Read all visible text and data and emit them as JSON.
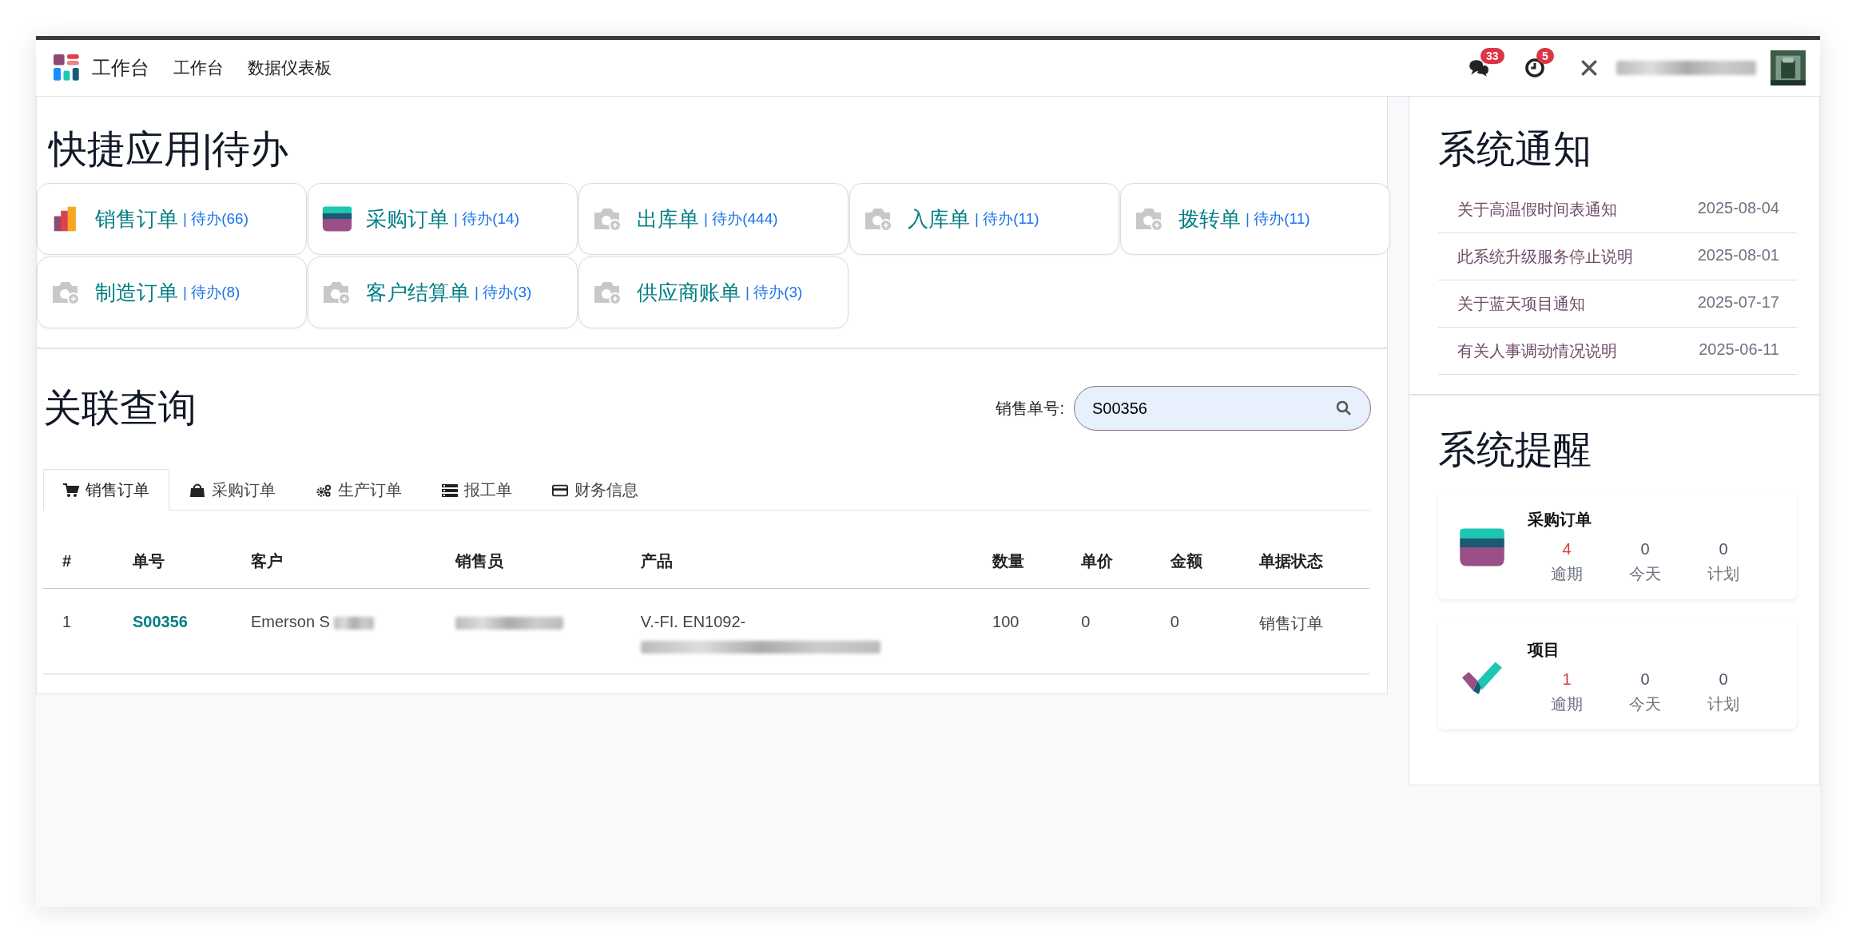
{
  "navbar": {
    "brand": "工作台",
    "menu": [
      {
        "label": "工作台"
      },
      {
        "label": "数据仪表板"
      }
    ],
    "messages_badge": "33",
    "activity_badge": "5"
  },
  "quick_apps": {
    "title": "快捷应用|待办",
    "items": [
      {
        "name": "销售订单",
        "todo": "| 待办(66)",
        "kind": "chart"
      },
      {
        "name": "采购订单",
        "todo": "| 待办(14)",
        "kind": "stack"
      },
      {
        "name": "出库单",
        "todo": "| 待办(444)",
        "kind": "camera"
      },
      {
        "name": "入库单",
        "todo": "| 待办(11)",
        "kind": "camera"
      },
      {
        "name": "拨转单",
        "todo": "| 待办(11)",
        "kind": "camera"
      },
      {
        "name": "制造订单",
        "todo": "| 待办(8)",
        "kind": "camera"
      },
      {
        "name": "客户结算单",
        "todo": "| 待办(3)",
        "kind": "camera"
      },
      {
        "name": "供应商账单",
        "todo": "| 待办(3)",
        "kind": "camera"
      }
    ]
  },
  "lookup": {
    "title": "关联查询",
    "search": {
      "label": "销售单号:",
      "value": "S00356"
    },
    "tabs": [
      {
        "label": "销售订单",
        "kind": "cart",
        "selected": true
      },
      {
        "label": "采购订单",
        "kind": "bag",
        "selected": false
      },
      {
        "label": "生产订单",
        "kind": "cogs",
        "selected": false
      },
      {
        "label": "报工单",
        "kind": "list",
        "selected": false
      },
      {
        "label": "财务信息",
        "kind": "card",
        "selected": false
      }
    ],
    "table": {
      "columns": [
        "#",
        "单号",
        "客户",
        "销售员",
        "产品",
        "数量",
        "单价",
        "金额",
        "单据状态"
      ],
      "rows": [
        {
          "index": "1",
          "number": "S00356",
          "customer": {
            "text": "Emerson S",
            "redacted": true
          },
          "salesperson": {
            "redacted": true
          },
          "product": {
            "text": "V.-FI. EN1092-",
            "redacted": true
          },
          "quantity": "100",
          "unit_price": "0",
          "amount": "0",
          "status": "销售订单"
        }
      ]
    }
  },
  "notices": {
    "title": "系统通知",
    "items": [
      {
        "title": "关于高温假时间表通知",
        "date": "2025-08-04"
      },
      {
        "title": "此系统升级服务停止说明",
        "date": "2025-08-01"
      },
      {
        "title": "关于蓝天项目通知",
        "date": "2025-07-17"
      },
      {
        "title": "有关人事调动情况说明",
        "date": "2025-06-11"
      }
    ]
  },
  "reminders": {
    "title": "系统提醒",
    "items": [
      {
        "name": "采购订单",
        "kind": "stack",
        "stats": [
          {
            "value": "4",
            "label": "逾期",
            "color": "#d23f3a"
          },
          {
            "value": "0",
            "label": "今天",
            "color": "#4b5563"
          },
          {
            "value": "0",
            "label": "计划",
            "color": "#4b5563"
          }
        ]
      },
      {
        "name": "项目",
        "kind": "check",
        "stats": [
          {
            "value": "1",
            "label": "逾期",
            "color": "#d23f3a"
          },
          {
            "value": "0",
            "label": "今天",
            "color": "#4b5563"
          },
          {
            "value": "0",
            "label": "计划",
            "color": "#4b5563"
          }
        ]
      }
    ]
  }
}
